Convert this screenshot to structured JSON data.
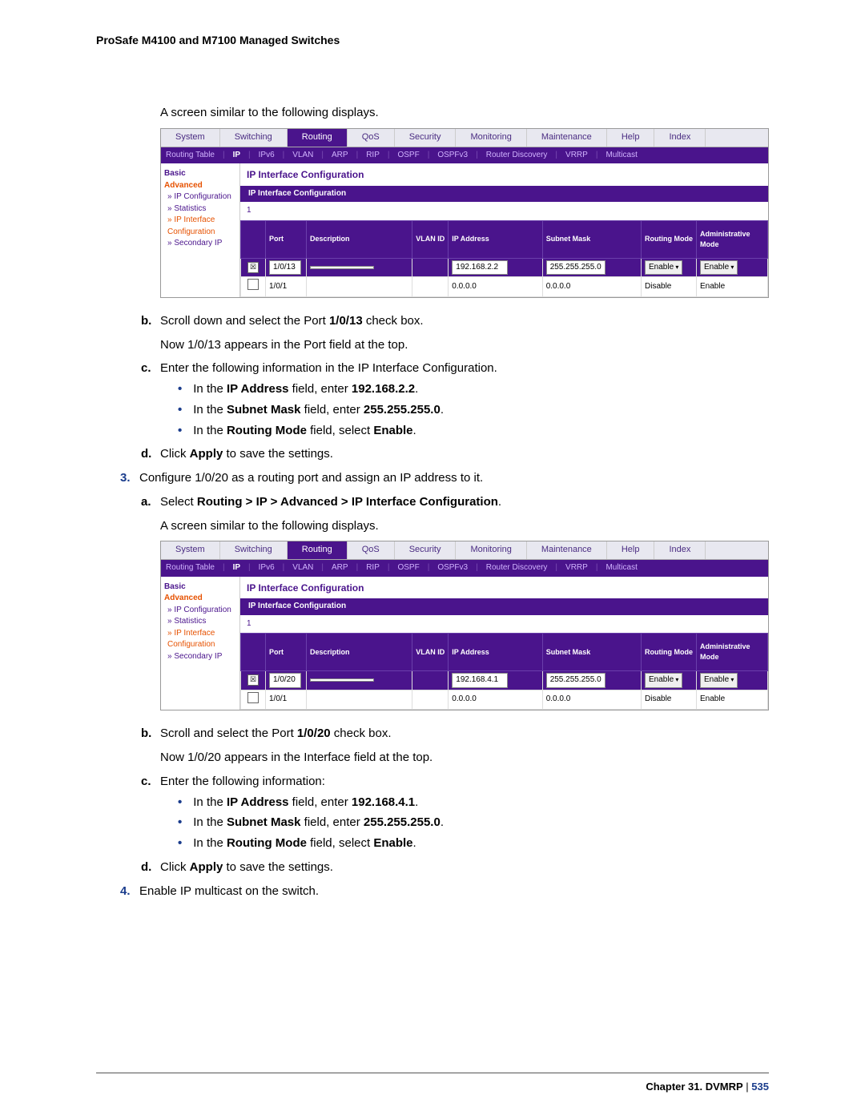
{
  "doc_title": "ProSafe M4100 and M7100 Managed Switches",
  "intro_1": "A screen similar to the following displays.",
  "screenshot": {
    "tabs": [
      "System",
      "Switching",
      "Routing",
      "QoS",
      "Security",
      "Monitoring",
      "Maintenance",
      "Help",
      "Index"
    ],
    "active_tab": "Routing",
    "subtabs": [
      "Routing Table",
      "IP",
      "IPv6",
      "VLAN",
      "ARP",
      "RIP",
      "OSPF",
      "OSPFv3",
      "Router Discovery",
      "VRRP",
      "Multicast"
    ],
    "active_subtab": "IP",
    "sidebar": {
      "basic": "Basic",
      "adv": "Advanced",
      "items": [
        "» IP Configuration",
        "» Statistics",
        "» IP Interface",
        "   Configuration",
        "» Secondary IP"
      ]
    },
    "panel_title": "IP Interface Configuration",
    "bar": "IP Interface Configuration",
    "filter": "1",
    "headers": [
      "",
      "Port",
      "Description",
      "VLAN ID",
      "IP Address",
      "Subnet Mask",
      "Routing Mode",
      "Administrative Mode"
    ]
  },
  "shot1_row1": {
    "port": "1/0/13",
    "ip": "192.168.2.2",
    "mask": "255.255.255.0",
    "rmode": "Enable",
    "amode": "Enable"
  },
  "shot1_row2": {
    "port": "1/0/1",
    "ip": "0.0.0.0",
    "mask": "0.0.0.0",
    "rmode": "Disable",
    "amode": "Enable"
  },
  "shot2_row1": {
    "port": "1/0/20",
    "ip": "192.168.4.1",
    "mask": "255.255.255.0",
    "rmode": "Enable",
    "amode": "Enable"
  },
  "shot2_row2": {
    "port": "1/0/1",
    "ip": "0.0.0.0",
    "mask": "0.0.0.0",
    "rmode": "Disable",
    "amode": "Enable"
  },
  "step_b1_a": "Scroll down and select the Port ",
  "step_b1_bold": "1/0/13",
  "step_b1_b": " check box.",
  "step_b1_2": "Now 1/0/13 appears in the Port field at the top.",
  "step_c1": "Enter the following information in the IP Interface Configuration.",
  "bullet1_a": "In the ",
  "bullet1_b": "IP Address",
  "bullet1_c": " field, enter ",
  "bullet1_d": "192.168.2.2",
  "bullet1_e": ".",
  "bullet2_a": "In the ",
  "bullet2_b": "Subnet Mask",
  "bullet2_c": " field, enter ",
  "bullet2_d": "255.255.255.0",
  "bullet2_e": ".",
  "bullet3_a": "In the ",
  "bullet3_b": "Routing Mode",
  "bullet3_c": " field, select ",
  "bullet3_d": "Enable",
  "bullet3_e": ".",
  "step_d1_a": "Click ",
  "step_d1_b": "Apply",
  "step_d1_c": " to save the settings.",
  "step3": "Configure 1/0/20 as a routing port and assign an IP address to it.",
  "step_a2_a": "Select ",
  "step_a2_b": "Routing > IP > Advanced > IP Interface Configuration",
  "step_a2_c": ".",
  "intro_2": "A screen similar to the following displays.",
  "step_b2_a": "Scroll and select the Port ",
  "step_b2_bold": "1/0/20",
  "step_b2_b": " check box.",
  "step_b2_2": "Now 1/0/20 appears in the Interface field at the top.",
  "step_c2": "Enter the following information:",
  "b21_a": "In the ",
  "b21_b": "IP Address",
  "b21_c": " field, enter ",
  "b21_d": "192.168.4.1",
  "b21_e": ".",
  "b22_a": "In the ",
  "b22_b": "Subnet Mask",
  "b22_c": " field, enter ",
  "b22_d": "255.255.255.0",
  "b22_e": ".",
  "b23_a": "In the ",
  "b23_b": "Routing Mode",
  "b23_c": " field, select ",
  "b23_d": "Enable",
  "b23_e": ".",
  "step_d2_a": "Click ",
  "step_d2_b": "Apply",
  "step_d2_c": " to save the settings.",
  "step4": "Enable IP multicast on the switch.",
  "footer_chapter": "Chapter 31.  DVMRP",
  "footer_sep": "   |   ",
  "footer_page": "535"
}
